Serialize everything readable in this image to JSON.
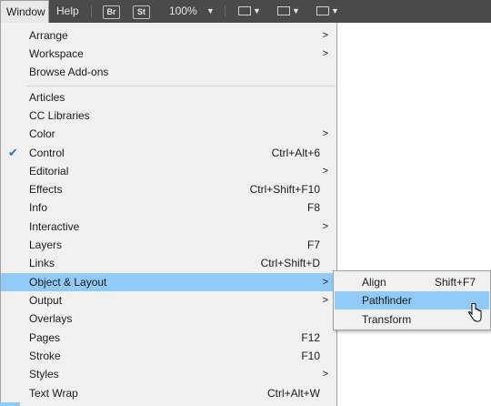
{
  "appbar": {
    "window_label": "Window",
    "help_label": "Help",
    "br_label": "Br",
    "st_label": "St",
    "zoom_label": "100%",
    "caret": "▼"
  },
  "menu": {
    "items": [
      {
        "label": "Arrange",
        "shortcut": "",
        "submenu": true
      },
      {
        "label": "Workspace",
        "shortcut": "",
        "submenu": true
      },
      {
        "label": "Browse Add-ons",
        "shortcut": "",
        "submenu": false
      },
      {
        "label": "Articles",
        "shortcut": "",
        "submenu": false
      },
      {
        "label": "CC Libraries",
        "shortcut": "",
        "submenu": false
      },
      {
        "label": "Color",
        "shortcut": "",
        "submenu": true
      },
      {
        "label": "Control",
        "shortcut": "Ctrl+Alt+6",
        "submenu": false,
        "checked": true
      },
      {
        "label": "Editorial",
        "shortcut": "",
        "submenu": true
      },
      {
        "label": "Effects",
        "shortcut": "Ctrl+Shift+F10",
        "submenu": false
      },
      {
        "label": "Info",
        "shortcut": "F8",
        "submenu": false
      },
      {
        "label": "Interactive",
        "shortcut": "",
        "submenu": true
      },
      {
        "label": "Layers",
        "shortcut": "F7",
        "submenu": false
      },
      {
        "label": "Links",
        "shortcut": "Ctrl+Shift+D",
        "submenu": false
      },
      {
        "label": "Object & Layout",
        "shortcut": "",
        "submenu": true,
        "highlighted": true
      },
      {
        "label": "Output",
        "shortcut": "",
        "submenu": true
      },
      {
        "label": "Overlays",
        "shortcut": "",
        "submenu": false
      },
      {
        "label": "Pages",
        "shortcut": "F12",
        "submenu": false
      },
      {
        "label": "Stroke",
        "shortcut": "F10",
        "submenu": false
      },
      {
        "label": "Styles",
        "shortcut": "",
        "submenu": true
      },
      {
        "label": "Text Wrap",
        "shortcut": "Ctrl+Alt+W",
        "submenu": false
      }
    ],
    "arrow": ">",
    "check": "✔"
  },
  "submenu": {
    "items": [
      {
        "label": "Align",
        "shortcut": "Shift+F7"
      },
      {
        "label": "Pathfinder",
        "shortcut": "",
        "highlighted": true
      },
      {
        "label": "Transform",
        "shortcut": ""
      }
    ]
  },
  "colors": {
    "highlight": "#91c9f7",
    "menu_bg": "#f0f0f0",
    "appbar_bg": "#4a4a4a",
    "check": "#2b6fc6"
  }
}
